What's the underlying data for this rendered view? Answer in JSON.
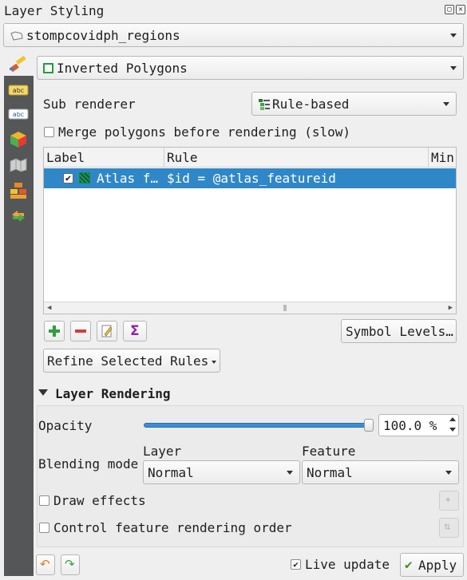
{
  "window": {
    "title": "Layer Styling"
  },
  "layer_selector": {
    "value": "stompcovidph_regions"
  },
  "renderer": {
    "value": "Inverted Polygons"
  },
  "sub_renderer": {
    "label": "Sub renderer",
    "value": "Rule-based"
  },
  "merge_polygons": {
    "label": "Merge polygons before rendering (slow)",
    "checked": false
  },
  "rules_table": {
    "headers": [
      "Label",
      "Rule",
      "Min"
    ],
    "rows": [
      {
        "checked": true,
        "label": "Atlas f…",
        "rule": "$id = @atlas_featureid"
      }
    ]
  },
  "buttons": {
    "symbol_levels": "Symbol Levels…",
    "refine_selected_rules": "Refine Selected Rules",
    "apply": "Apply"
  },
  "layer_rendering": {
    "title": "Layer Rendering",
    "opacity_label": "Opacity",
    "opacity_value": "100.0 %",
    "opacity_fraction": 1.0,
    "blending_label": "Blending mode",
    "layer_label": "Layer",
    "feature_label": "Feature",
    "layer_blend": "Normal",
    "feature_blend": "Normal",
    "draw_effects": "Draw effects",
    "control_order": "Control feature rendering order"
  },
  "footer": {
    "live_update": "Live update",
    "live_update_checked": true
  },
  "colors": {
    "accent": "#2f87c8",
    "sidebar": "#555657"
  }
}
